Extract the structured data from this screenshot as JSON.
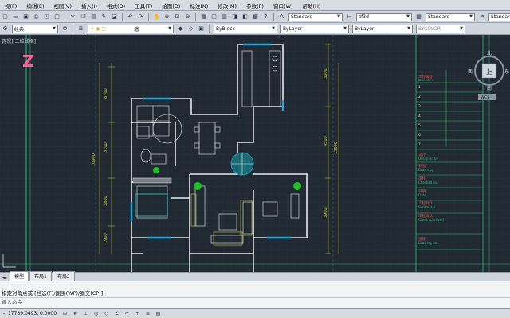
{
  "menu": [
    "视(F)",
    "编辑(E)",
    "视图(V)",
    "插入(I)",
    "格式(O)",
    "工具(T)",
    "绘图(D)",
    "标注(N)",
    "修改(M)",
    "参数(P)",
    "窗口(W)",
    "帮助(H)"
  ],
  "toolbar": {
    "text_style": "Standard",
    "dim_style": "zf3d",
    "table_style": "Standard",
    "multileader_style": "Standard",
    "workspace": "经典",
    "layer": "墙",
    "color": "ByBlock",
    "linetype": "ByLayer",
    "lineweight": "ByLayer",
    "plotstyle": "BYCOLOR"
  },
  "viewport": {
    "label": "俯视][二维线框]",
    "watermark": "Z"
  },
  "viewcube": {
    "north": "北",
    "south": "南",
    "east": "东",
    "west": "西",
    "top": "上",
    "wcs": "WCS"
  },
  "plan": {
    "dims_left": [
      "8700",
      "3100",
      "10900",
      "3800",
      "1900"
    ],
    "dims_right": [
      "3600",
      "4500",
      "3900",
      "3900"
    ],
    "dims_right_total": "13000"
  },
  "title_block": {
    "project": "工程编号",
    "project_en": "Job. no.",
    "rows": [
      "1",
      "2",
      "3",
      "4",
      "5",
      "6",
      "7"
    ],
    "design": "设计",
    "design_en": "Designed by",
    "draw": "制图",
    "draw_en": "Drawn by",
    "check": "审核",
    "check_en": "Checked by",
    "date": "日期",
    "date_en": "Date",
    "contractor": "工程制作",
    "contractor_en": "Contractor",
    "approve": "审核确认",
    "approve_en": "Client approved",
    "number": "图号",
    "number_en": "Drawing no."
  },
  "tabs": {
    "model": "模型",
    "layout1": "布局1",
    "layout2": "布局2"
  },
  "command": {
    "line1": "指定对角点或 [栏选(F)/圈围(WP)/圈交(CP)]:",
    "line2": "键入命令"
  },
  "status": {
    "coords": "-, 17789.0493, 0.0000"
  },
  "colors": {
    "canvas": "#212a33",
    "wall": "#e6e9ee",
    "window": "#1fa8d8",
    "dim": "#c8cf3a",
    "border": "#20c070"
  }
}
